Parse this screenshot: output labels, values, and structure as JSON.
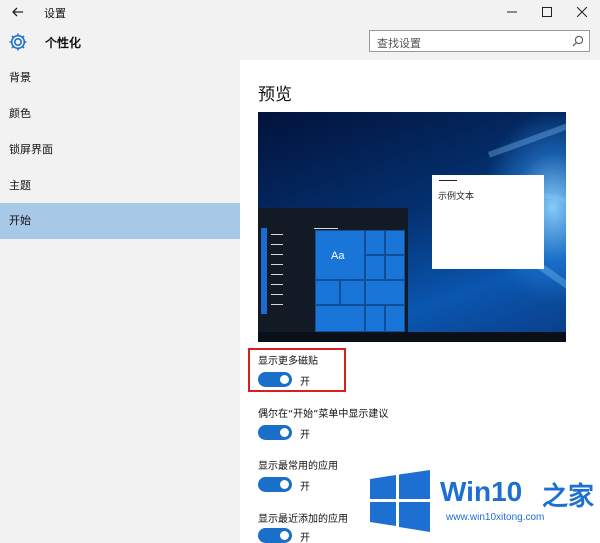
{
  "window": {
    "title": "设置",
    "back_icon": "arrow-left-icon",
    "minimize_icon": "minimize-icon",
    "maximize_icon": "maximize-icon",
    "close_icon": "close-icon"
  },
  "header": {
    "section_title": "个性化",
    "icon": "gear-icon",
    "search_placeholder": "查找设置"
  },
  "sidebar": {
    "items": [
      {
        "label": "背景",
        "active": false
      },
      {
        "label": "颜色",
        "active": false
      },
      {
        "label": "锁屏界面",
        "active": false
      },
      {
        "label": "主题",
        "active": false
      },
      {
        "label": "开始",
        "active": true
      }
    ],
    "active_color": "#a7c8e6"
  },
  "main": {
    "heading": "预览",
    "preview": {
      "tile_text": "Aa",
      "sample_text": "示例文本"
    },
    "settings": [
      {
        "label": "显示更多磁贴",
        "state": "开",
        "on": true
      },
      {
        "label": "偶尔在“开始”菜单中显示建议",
        "state": "开",
        "on": true
      },
      {
        "label": "显示最常用的应用",
        "state": "开",
        "on": true
      },
      {
        "label": "显示最近添加的应用",
        "state": "开",
        "on": true
      }
    ],
    "toggle_color": "#1a6fc9",
    "highlight_color": "#d62020"
  },
  "watermark": {
    "brand": "Win10",
    "brand_suffix": "之家",
    "url": "www.win10xitong.com",
    "color": "#1d6fd1"
  }
}
